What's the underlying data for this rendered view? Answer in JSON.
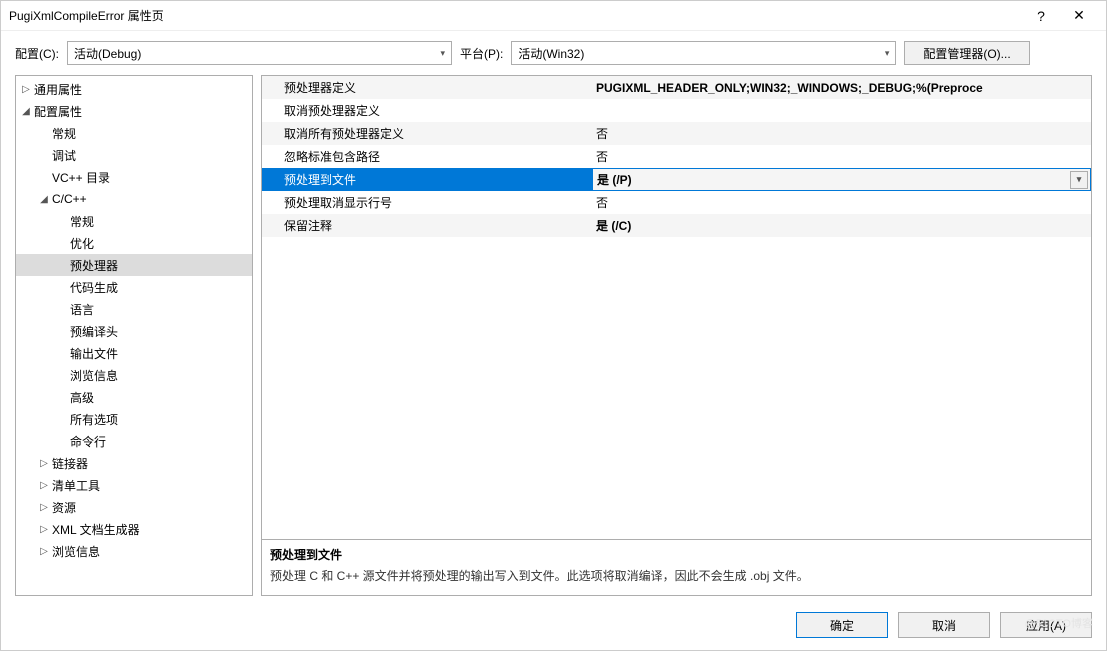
{
  "title": "PugiXmlCompileError 属性页",
  "titlebar": {
    "help": "?",
    "close": "✕"
  },
  "topbar": {
    "config_label": "配置(C):",
    "config_value": "活动(Debug)",
    "platform_label": "平台(P):",
    "platform_value": "活动(Win32)",
    "manager_btn": "配置管理器(O)..."
  },
  "tree": [
    {
      "label": "通用属性",
      "depth": 0,
      "arrow": "▷"
    },
    {
      "label": "配置属性",
      "depth": 0,
      "arrow": "◢"
    },
    {
      "label": "常规",
      "depth": 1,
      "arrow": ""
    },
    {
      "label": "调试",
      "depth": 1,
      "arrow": ""
    },
    {
      "label": "VC++ 目录",
      "depth": 1,
      "arrow": ""
    },
    {
      "label": "C/C++",
      "depth": 1,
      "arrow": "◢"
    },
    {
      "label": "常规",
      "depth": 2,
      "arrow": ""
    },
    {
      "label": "优化",
      "depth": 2,
      "arrow": ""
    },
    {
      "label": "预处理器",
      "depth": 2,
      "arrow": "",
      "selected": true
    },
    {
      "label": "代码生成",
      "depth": 2,
      "arrow": ""
    },
    {
      "label": "语言",
      "depth": 2,
      "arrow": ""
    },
    {
      "label": "预编译头",
      "depth": 2,
      "arrow": ""
    },
    {
      "label": "输出文件",
      "depth": 2,
      "arrow": ""
    },
    {
      "label": "浏览信息",
      "depth": 2,
      "arrow": ""
    },
    {
      "label": "高级",
      "depth": 2,
      "arrow": ""
    },
    {
      "label": "所有选项",
      "depth": 2,
      "arrow": ""
    },
    {
      "label": "命令行",
      "depth": 2,
      "arrow": ""
    },
    {
      "label": "链接器",
      "depth": 1,
      "arrow": "▷"
    },
    {
      "label": "清单工具",
      "depth": 1,
      "arrow": "▷"
    },
    {
      "label": "资源",
      "depth": 1,
      "arrow": "▷"
    },
    {
      "label": "XML 文档生成器",
      "depth": 1,
      "arrow": "▷"
    },
    {
      "label": "浏览信息",
      "depth": 1,
      "arrow": "▷"
    }
  ],
  "grid": [
    {
      "label": "预处理器定义",
      "value": "PUGIXML_HEADER_ONLY;WIN32;_WINDOWS;_DEBUG;%(Preproce",
      "bold": true
    },
    {
      "label": "取消预处理器定义",
      "value": ""
    },
    {
      "label": "取消所有预处理器定义",
      "value": "否"
    },
    {
      "label": "忽略标准包含路径",
      "value": "否"
    },
    {
      "label": "预处理到文件",
      "value": "是 (/P)",
      "bold": true,
      "selected": true
    },
    {
      "label": "预处理取消显示行号",
      "value": "否"
    },
    {
      "label": "保留注释",
      "value": "是 (/C)",
      "bold": true
    }
  ],
  "desc": {
    "title": "预处理到文件",
    "text": "预处理 C 和 C++ 源文件并将预处理的输出写入到文件。此选项将取消编译，因此不会生成 .obj 文件。"
  },
  "footer": {
    "ok": "确定",
    "cancel": "取消",
    "apply": "应用(A)"
  },
  "watermark": "@51CTO博客"
}
